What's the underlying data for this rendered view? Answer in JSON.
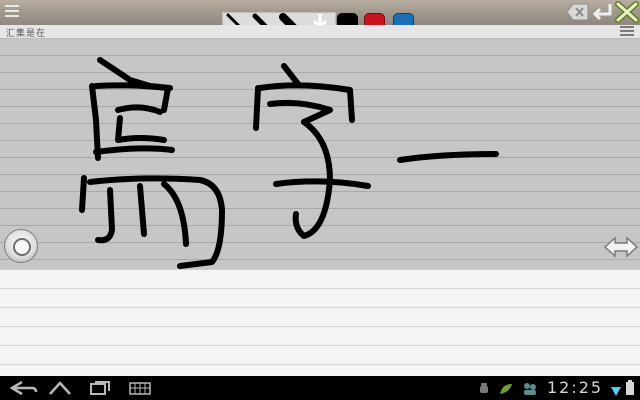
{
  "preview": {
    "text": "汇集是在"
  },
  "toolbar": {
    "pen_sizes": [
      "thin",
      "medium",
      "thick"
    ],
    "colors": [
      {
        "name": "black",
        "hex": "#000000"
      },
      {
        "name": "red",
        "hex": "#c8141e"
      },
      {
        "name": "blue",
        "hex": "#1a6fb8"
      }
    ]
  },
  "icons": {
    "menu": "hamburger-menu-icon",
    "erase": "backspace-icon",
    "enter": "enter-icon",
    "close": "close-icon",
    "upload": "download-arrow-icon",
    "circle": "circle-button-icon",
    "resize": "horizontal-arrows-icon"
  },
  "status_bar": {
    "time": "12:25",
    "accent": "#5ec8f0"
  }
}
